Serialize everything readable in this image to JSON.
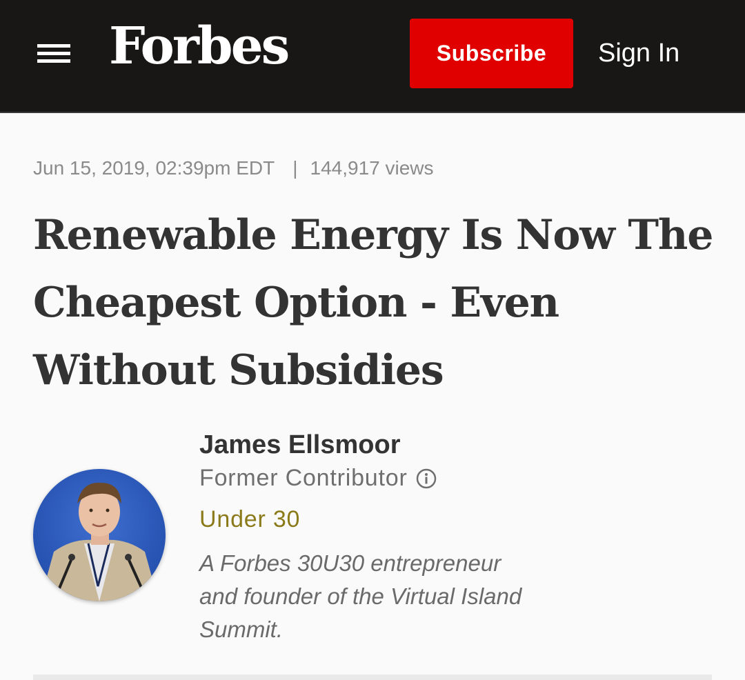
{
  "header": {
    "logo": "Forbes",
    "subscribe_label": "Subscribe",
    "signin_label": "Sign In",
    "background": "#181716",
    "accent": "#e00000"
  },
  "article": {
    "date": "Jun 15, 2019, 02:39pm EDT",
    "separator": "|",
    "views": "144,917 views",
    "headline": "Renewable Energy Is Now The Cheapest Option - Even Without Subsidies"
  },
  "author": {
    "name": "James Ellsmoor",
    "role": "Former Contributor",
    "badge": "Under 30",
    "bio": "A Forbes 30U30 entrepreneur and founder of the Virtual Island Summit."
  }
}
